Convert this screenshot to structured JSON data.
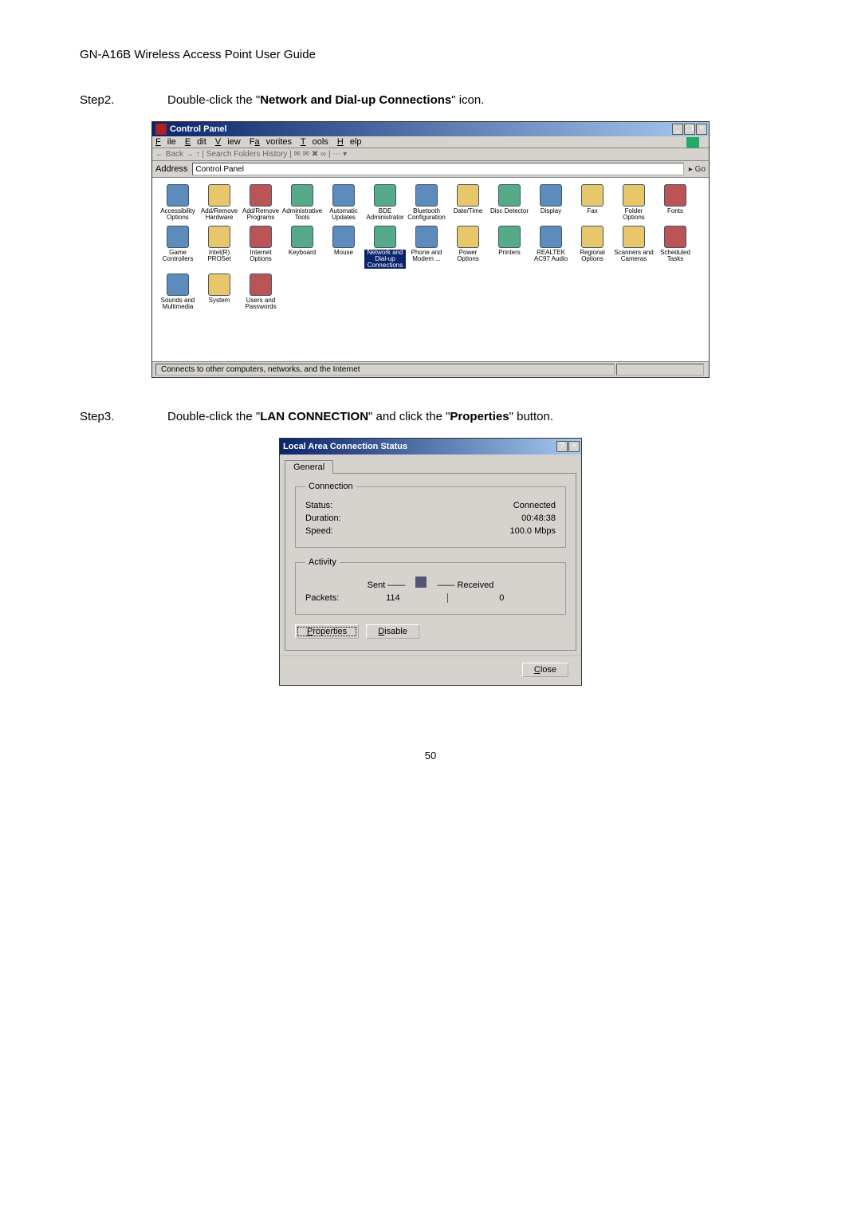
{
  "doc": {
    "header": "GN-A16B Wireless Access Point  User Guide"
  },
  "steps": {
    "s2": {
      "label": "Step2.",
      "pre": "Double-click the \"",
      "bold": "Network and Dial-up Connections",
      "post": "\" icon."
    },
    "s3": {
      "label": "Step3.",
      "pre": "Double-click the \"",
      "bold1": "LAN CONNECTION",
      "mid": "\" and click the \"",
      "bold2": "Properties",
      "post": "\" button."
    }
  },
  "cp": {
    "title": "Control Panel",
    "menu": {
      "file": "File",
      "edit": "Edit",
      "view": "View",
      "fav": "Favorites",
      "tools": "Tools",
      "help": "Help"
    },
    "toolbar": "← Back  →  ↑  |  Search   Folders   History  |  ✉ ✉ ✖ ∞  | ⋯ ▾",
    "address": {
      "label": "Address",
      "value": "Control Panel",
      "go": "Go"
    },
    "icons": [
      "Accessibility Options",
      "Add/Remove Hardware",
      "Add/Remove Programs",
      "Administrative Tools",
      "Automatic Updates",
      "BDE Administrator",
      "Bluetooth Configuration",
      "Date/Time",
      "Disc Detector",
      "Display",
      "Fax",
      "Folder Options",
      "Fonts",
      "Game Controllers",
      "Intel(R) PROSet",
      "Internet Options",
      "Keyboard",
      "Mouse",
      "Network and Dial-up Connections",
      "Phone and Modem ...",
      "Power Options",
      "Printers",
      "REALTEK AC97 Audio",
      "Regional Options",
      "Scanners and Cameras",
      "Scheduled Tasks",
      "Sounds and Multimedia",
      "System",
      "Users and Passwords"
    ],
    "selected": 18,
    "status": "Connects to other computers, networks, and the Internet"
  },
  "dlg": {
    "title": "Local Area Connection Status",
    "tab": "General",
    "conn": {
      "legend": "Connection",
      "status_l": "Status:",
      "status_v": "Connected",
      "dur_l": "Duration:",
      "dur_v": "00:48:38",
      "spd_l": "Speed:",
      "spd_v": "100.0 Mbps"
    },
    "act": {
      "legend": "Activity",
      "sent": "Sent",
      "recv": "Received",
      "pkts_l": "Packets:",
      "pkts_s": "114",
      "pkts_r": "0"
    },
    "btns": {
      "props": "Properties",
      "dis": "Disable",
      "close": "Close"
    }
  },
  "page_no": "50"
}
